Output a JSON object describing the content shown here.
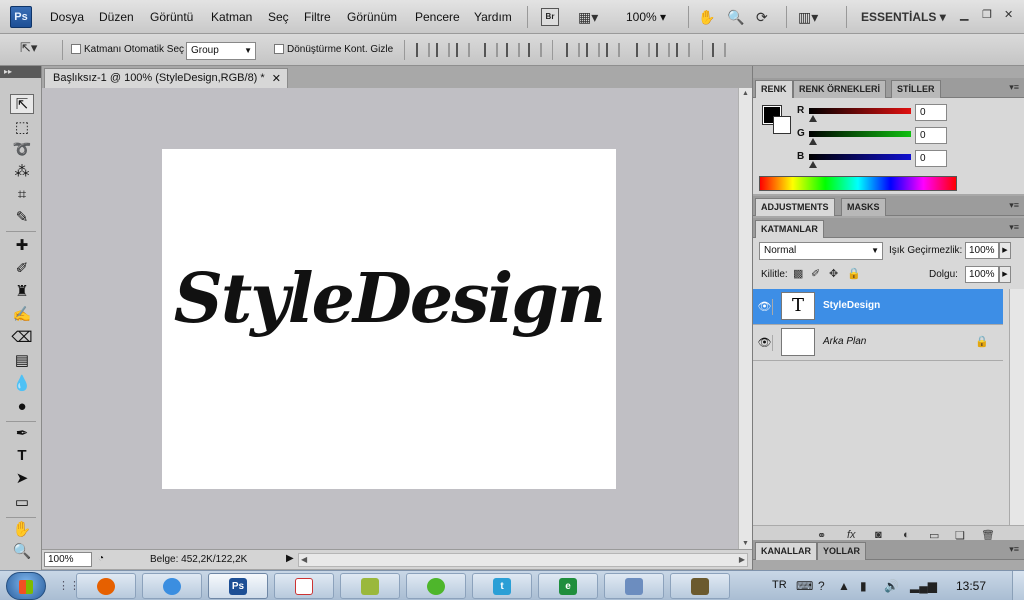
{
  "menubar": {
    "logo": "Ps",
    "items": [
      "Dosya",
      "Düzen",
      "Görüntü",
      "Katman",
      "Seç",
      "Filtre",
      "Görünüm",
      "Pencere",
      "Yardım"
    ],
    "bridge_label": "Br",
    "zoom": "100%",
    "workspace": "ESSENTİALS"
  },
  "options": {
    "auto_select_label": "Katmanı Otomatik Seç",
    "auto_select_value": "Group",
    "transform_label": "Dönüştürme Kont. Gizle"
  },
  "document": {
    "tab_title": "Başlıksız-1 @ 100% (StyleDesign,RGB/8) *",
    "canvas_text": "StyleDesign",
    "canvas_bg": "#ffffff"
  },
  "status": {
    "zoom": "100%",
    "doc_size": "Belge: 452,2K/122,2K"
  },
  "color_panel": {
    "tabs": [
      "RENK",
      "RENK ÖRNEKLERİ",
      "STİLLER"
    ],
    "channels": [
      {
        "label": "R",
        "value": "0",
        "color": "#d01010"
      },
      {
        "label": "G",
        "value": "0",
        "color": "#10b010"
      },
      {
        "label": "B",
        "value": "0",
        "color": "#1010c0"
      }
    ],
    "foreground": "#000000",
    "background": "#ffffff"
  },
  "adjust_panel": {
    "tabs": [
      "ADJUSTMENTS",
      "MASKS"
    ]
  },
  "layers_panel": {
    "tab": "KATMANLAR",
    "blend_mode": "Normal",
    "opacity_label": "Işık Geçirmezlik:",
    "opacity": "100%",
    "lock_label": "Kilitle:",
    "fill_label": "Dolgu:",
    "fill": "100%",
    "layers": [
      {
        "name": "StyleDesign",
        "thumb": "T",
        "selected": true
      },
      {
        "name": "Arka Plan",
        "thumb": "",
        "selected": false
      }
    ],
    "selection_color": "#3d8ee6"
  },
  "channels_panel": {
    "tabs": [
      "KANALLAR",
      "YOLLAR"
    ]
  },
  "taskbar": {
    "apps": [
      {
        "name": "firefox",
        "color": "#e66000",
        "glyph": ""
      },
      {
        "name": "chrome",
        "color": "#3b8ee0",
        "glyph": ""
      },
      {
        "name": "photoshop",
        "color": "#1d4f95",
        "glyph": "Ps"
      },
      {
        "name": "pdf",
        "color": "#ffffff",
        "glyph": ""
      },
      {
        "name": "app-green",
        "color": "#9ab83c",
        "glyph": ""
      },
      {
        "name": "app-lime",
        "color": "#4eb62b",
        "glyph": ""
      },
      {
        "name": "app-blue",
        "color": "#2a9fd6",
        "glyph": "t"
      },
      {
        "name": "app-excel",
        "color": "#1f8e3d",
        "glyph": "e"
      },
      {
        "name": "app-doc",
        "color": "#6c8dbf",
        "glyph": ""
      },
      {
        "name": "app-media",
        "color": "#6b5a2e",
        "glyph": ""
      }
    ],
    "language": "TR",
    "time": "13:57"
  }
}
